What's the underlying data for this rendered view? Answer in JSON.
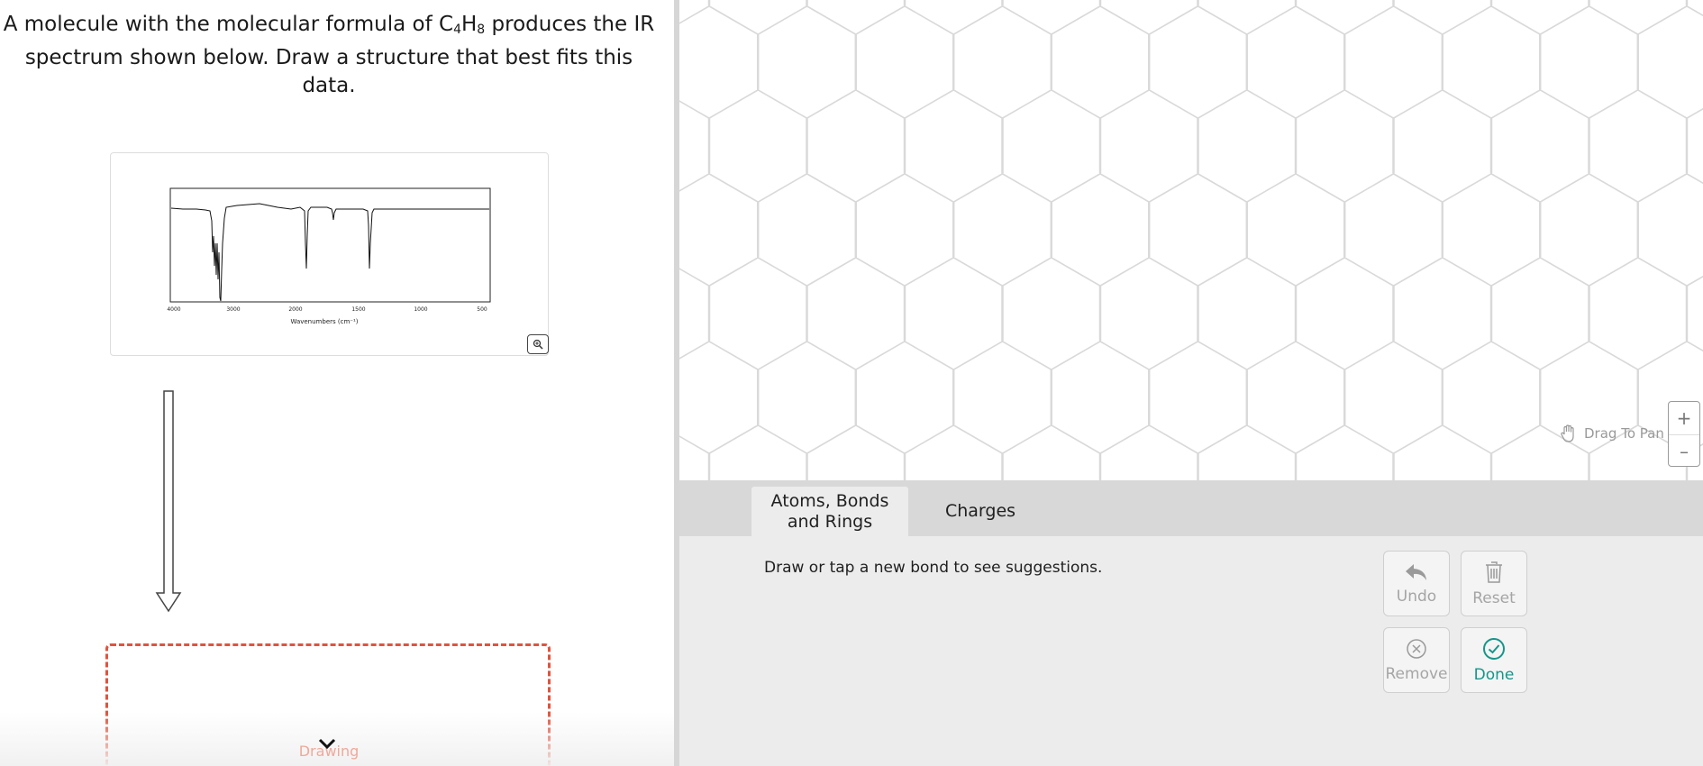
{
  "question": {
    "line1_pre": "A molecule with the molecular formula of C",
    "c_count": "4",
    "h_letter": "H",
    "h_count": "8",
    "line1_post": " produces the IR",
    "line2": "spectrum shown below. Draw a structure that best fits this data."
  },
  "spectrum": {
    "x_ticks": [
      "4000",
      "3000",
      "2000",
      "1500",
      "1000",
      "500"
    ],
    "x_label": "Wavenumbers (cm⁻¹)",
    "zoom_icon": "magnifier-icon"
  },
  "drawing_area": {
    "label": "Drawing"
  },
  "editor": {
    "tabs": [
      {
        "line1": "Atoms, Bonds",
        "line2": "and Rings"
      },
      {
        "line1": "Charges"
      }
    ],
    "hint": "Draw or tap a new bond to see suggestions.",
    "drag_to_pan": "Drag To Pan",
    "zoom_in": "+",
    "zoom_out": "–",
    "buttons": {
      "undo": "Undo",
      "reset": "Reset",
      "remove": "Remove",
      "done": "Done"
    },
    "colors": {
      "accent": "#14968a",
      "drop_border": "#e0533d"
    }
  }
}
